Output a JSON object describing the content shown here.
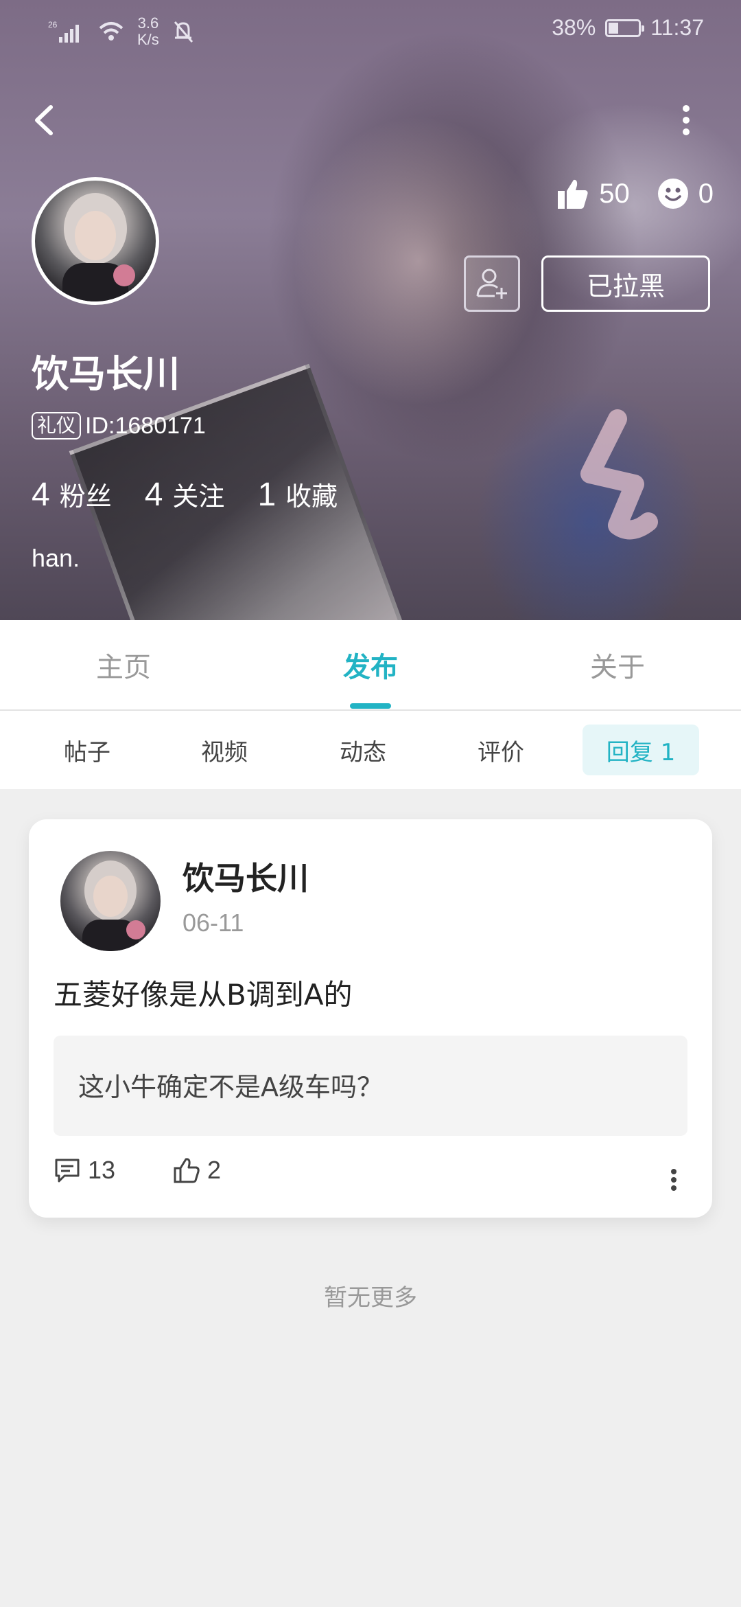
{
  "status_bar": {
    "signal_label": "26",
    "net_speed_value": "3.6",
    "net_speed_unit": "K/s",
    "battery_percent": "38%",
    "battery_level": 0.38,
    "time": "11:37"
  },
  "profile": {
    "likes": "50",
    "smiles": "0",
    "block_button_label": "已拉黑",
    "username": "饮马长川",
    "role_badge": "礼仪",
    "id_text": "ID:1680171",
    "stats": [
      {
        "count": "4",
        "label": "粉丝"
      },
      {
        "count": "4",
        "label": "关注"
      },
      {
        "count": "1",
        "label": "收藏"
      }
    ],
    "bio": "han."
  },
  "tabs": [
    {
      "label": "主页"
    },
    {
      "label": "发布"
    },
    {
      "label": "关于"
    }
  ],
  "sub_tabs": [
    {
      "label": "帖子"
    },
    {
      "label": "视频"
    },
    {
      "label": "动态"
    },
    {
      "label": "评价"
    },
    {
      "label": "回复 1"
    }
  ],
  "post": {
    "author": "饮马长川",
    "date": "06-11",
    "content": "五菱好像是从B调到A的",
    "quote": "这小牛确定不是A级车吗？",
    "comments": "13",
    "likes": "2"
  },
  "footer": {
    "no_more": "暂无更多"
  },
  "colors": {
    "accent": "#22b3c4",
    "page_bg": "#efefef"
  }
}
